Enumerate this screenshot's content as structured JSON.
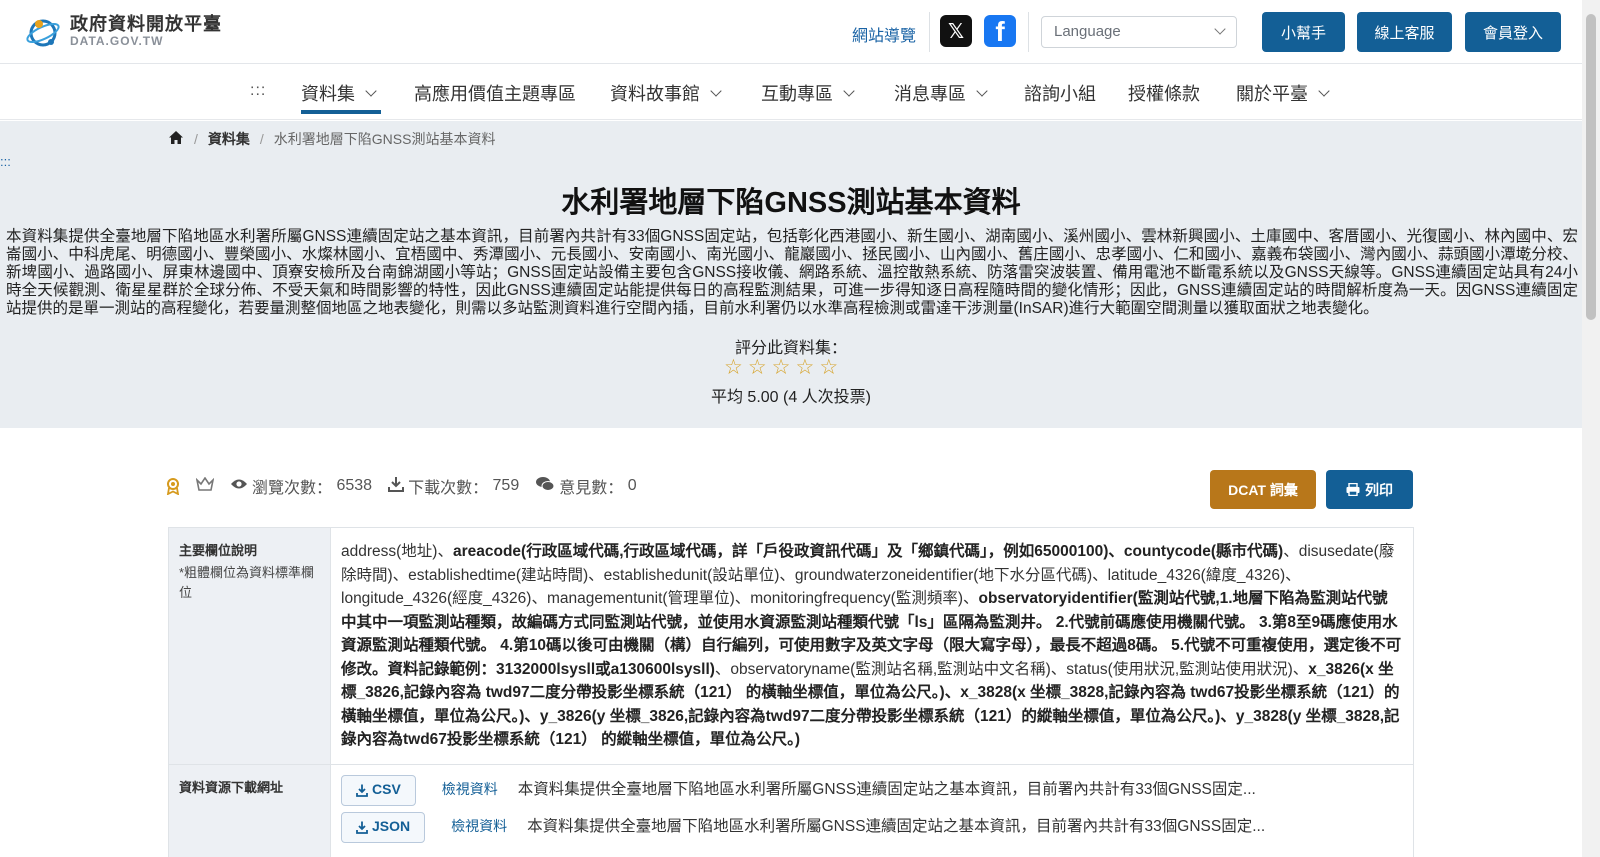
{
  "header": {
    "logo_title": "政府資料開放平臺",
    "logo_sub": "DATA.GOV.TW",
    "sitemap": "網站導覽",
    "language_placeholder": "Language",
    "buttons": {
      "helper": "小幫手",
      "support": "線上客服",
      "login": "會員登入"
    },
    "icons": {
      "x": "𝕏",
      "facebook": "f"
    }
  },
  "nav": {
    "dots": ":::",
    "items": [
      "資料集",
      "高應用價值主題專區",
      "資料故事館",
      "互動專區",
      "消息專區",
      "諮詢小組",
      "授權條款",
      "關於平臺"
    ]
  },
  "breadcrumb": {
    "level1": "資料集",
    "current": "水利署地層下陷GNSS測站基本資料"
  },
  "skip_dots": ":::",
  "dataset": {
    "title": "水利署地層下陷GNSS測站基本資料",
    "description": "本資料集提供全臺地層下陷地區水利署所屬GNSS連續固定站之基本資訊，目前署內共計有33個GNSS固定站，包括彰化西港國小、新生國小、湖南國小、溪州國小、雲林新興國小、土庫國中、客厝國小、光復國小、林內國中、宏崙國小、中科虎尾、明德國小、豐榮國小、水燦林國小、宜梧國中、秀潭國小、元長國小、安南國小、南光國小、龍巖國小、拯民國小、山內國小、舊庄國小、忠孝國小、仁和國小、嘉義布袋國小、灣內國小、蒜頭國小潭墘分校、新埤國小、過路國小、屏東林邊國中、頂寮安檢所及台南錦湖國小等站；GNSS固定站設備主要包含GNSS接收儀、網路系統、溫控散熱系統、防落雷突波裝置、備用電池不斷電系統以及GNSS天線等。GNSS連續固定站具有24小時全天候觀測、衛星星群於全球分佈、不受天氣和時間影響的特性，因此GNSS連續固定站能提供每日的高程監測結果，可進一步得知逐日高程隨時間的變化情形；因此，GNSS連續固定站的時間解析度為一天。因GNSS連續固定站提供的是單一測站的高程變化，若要量測整個地區之地表變化，則需以多站監測資料進行空間內插，目前水利署仍以水準高程檢測或雷達干涉測量(InSAR)進行大範圍空間測量以獲取面狀之地表變化。",
    "rate_label": "評分此資料集：",
    "rating_stars": 5,
    "avg": "平均 5.00 (4 人次投票)"
  },
  "stats": {
    "views_label": "瀏覽次數：",
    "views": "6538",
    "downloads_label": "下載次數：",
    "downloads": "759",
    "comments_label": "意見數：",
    "comments": "0",
    "dcat": "DCAT 詞彙",
    "print": "列印"
  },
  "table": {
    "fields_header": "主要欄位說明",
    "fields_note": "*粗體欄位為資料標準欄位",
    "fields_content": [
      {
        "t": "address(地址)、",
        "b": false
      },
      {
        "t": "areacode(行政區域代碼,行政區域代碼，詳「戶役政資訊代碼」及「鄉鎮代碼」，例如65000100)、countycode(縣市代碼)",
        "b": true
      },
      {
        "t": "、disusedate(廢除時間)、establishedtime(建站時間)、establishedunit(設站單位)、groundwaterzoneidentifier(地下水分區代碼)、latitude_4326(緯度_4326)、longitude_4326(經度_4326)、managementunit(管理單位)、monitoringfrequency(監測頻率)、",
        "b": false
      },
      {
        "t": "observatoryidentifier(監測站代號,1.地層下陷為監測站代號中其中一項監測站種類，故編碼方式同監測站代號，並使用水資源監測站種類代號「ls」區隔為監測井。 2.代號前碼應使用機關代號。 3.第8至9碼應使用水資源監測站種類代號。 4.第10碼以後可由機關（構）自行編列，可使用數字及英文字母（限大寫字母），最長不超過8碼。 5.代號不可重複使用，選定後不可修改。資料記錄範例：3132000lsysll或a130600lsysll)",
        "b": true
      },
      {
        "t": "、observatoryname(監測站名稱,監測站中文名稱)、status(使用狀況,監測站使用狀況)、",
        "b": false
      },
      {
        "t": "x_3826(x 坐標_3826,記錄內容為 twd97二度分帶投影坐標系統（121） 的橫軸坐標值，單位為公尺。)、x_3828(x 坐標_3828,記錄內容為 twd67投影坐標系統（121）的橫軸坐標值，單位為公尺。)、y_3826(y 坐標_3826,記錄內容為twd97二度分帶投影坐標系統（121）的縱軸坐標值，單位為公尺。)、y_3828(y 坐標_3828,記錄內容為twd67投影坐標系統（121） 的縱軸坐標值，單位為公尺。)",
        "b": true
      }
    ],
    "download_header": "資料資源下載網址",
    "downloads": [
      {
        "format": "CSV",
        "view": "檢視資料",
        "desc": "本資料集提供全臺地層下陷地區水利署所屬GNSS連續固定站之基本資訊，目前署內共計有33個GNSS固定..."
      },
      {
        "format": "JSON",
        "view": "檢視資料",
        "desc": "本資料集提供全臺地層下陷地區水利署所屬GNSS連續固定站之基本資訊，目前署內共計有33個GNSS固定..."
      }
    ]
  }
}
